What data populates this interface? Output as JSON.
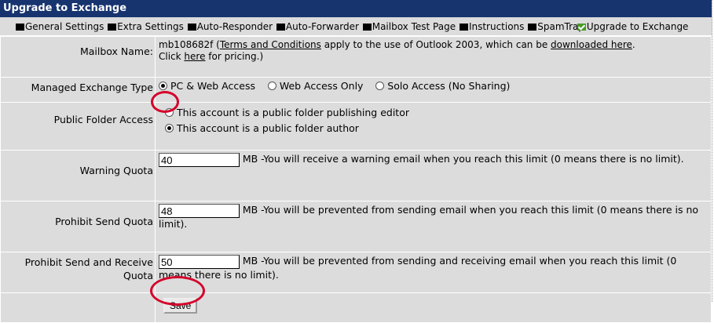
{
  "header": {
    "title": "Upgrade to Exchange"
  },
  "tabs": [
    {
      "label": "General Settings",
      "checked": false
    },
    {
      "label": "Extra Settings",
      "checked": false
    },
    {
      "label": "Auto-Responder",
      "checked": false
    },
    {
      "label": "Auto-Forwarder",
      "checked": false
    },
    {
      "label": "Mailbox Test Page",
      "checked": false
    },
    {
      "label": "Instructions",
      "checked": false
    },
    {
      "label": "SpamTrap",
      "checked": false
    },
    {
      "label": "Upgrade to Exchange",
      "checked": true
    }
  ],
  "mailbox": {
    "label": "Mailbox Name:",
    "name": "mb108682f",
    "paren_open": " (",
    "terms_link": "Terms and Conditions",
    "text_mid": " apply to the use of Outlook 2003, which can be ",
    "download_link": "downloaded here",
    "text_end": ".",
    "click": "Click ",
    "here_link": "here",
    "pricing": " for pricing.)"
  },
  "exchange_type": {
    "label": "Managed Exchange Type",
    "options": [
      "PC & Web Access",
      "Web Access Only",
      "Solo Access (No Sharing)"
    ],
    "selected": "PC & Web Access"
  },
  "public_folder": {
    "label": "Public Folder Access",
    "options": [
      "This account is a public folder publishing editor",
      "This account is a public folder author"
    ],
    "selected": "This account is a public folder author"
  },
  "quotas": {
    "warning": {
      "label": "Warning Quota",
      "value": "40",
      "unit": "MB",
      "desc": " -You will receive a warning email when you reach this limit (0 means there is no limit)."
    },
    "send": {
      "label": "Prohibit Send Quota",
      "value": "48",
      "unit": "MB",
      "desc": " -You will be prevented from sending email when you reach this limit (0 means there is no limit)."
    },
    "send_receive": {
      "label_line1": "Prohibit Send and Receive",
      "label_line2": "Quota",
      "value": "50",
      "unit": "MB",
      "desc": " -You will be prevented from sending and receiving email when you reach this limit (0 means there is no limit)."
    }
  },
  "save_label": "Save",
  "colors": {
    "header_bg": "#17346f",
    "panel_bg": "#dcdcdc",
    "highlight_circle": "#d4002a"
  }
}
